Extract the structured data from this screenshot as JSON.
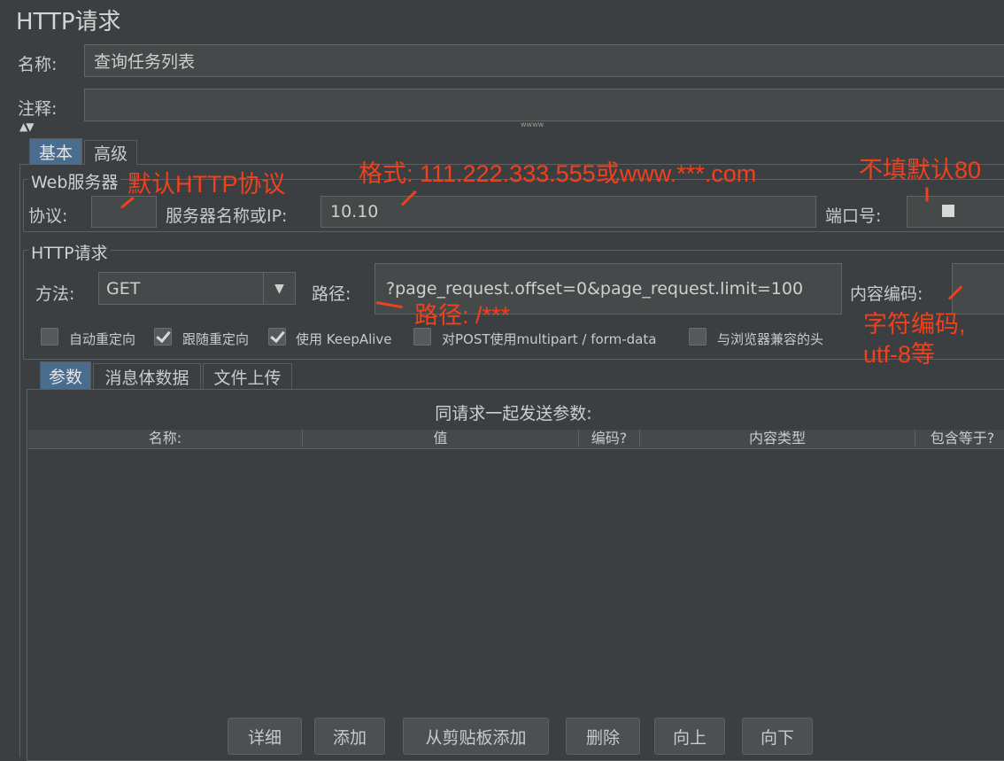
{
  "title": "HTTP请求",
  "name_label": "名称:",
  "name_value": "查询任务列表",
  "comment_label": "注释:",
  "comment_value": "",
  "collapse_icon": "▲▼",
  "splitter_icon": "wwww",
  "tabs": [
    "基本",
    "高级"
  ],
  "web_server": {
    "legend": "Web服务器",
    "protocol_label": "协议:",
    "protocol_value": "",
    "server_label": "服务器名称或IP:",
    "server_value": "10.10",
    "port_label": "端口号:",
    "port_value": ""
  },
  "http_request": {
    "legend": "HTTP请求",
    "method_label": "方法:",
    "method_value": "GET",
    "path_label": "路径:",
    "path_value": "?page_request.offset=0&page_request.limit=100",
    "encoding_label": "内容编码:",
    "encoding_value": ""
  },
  "checkboxes": [
    {
      "label": "自动重定向",
      "checked": false
    },
    {
      "label": "跟随重定向",
      "checked": true
    },
    {
      "label": "使用 KeepAlive",
      "checked": true
    },
    {
      "label": "对POST使用multipart / form-data",
      "checked": false
    },
    {
      "label": "与浏览器兼容的头",
      "checked": false
    }
  ],
  "subtabs": [
    "参数",
    "消息体数据",
    "文件上传"
  ],
  "params_caption": "同请求一起发送参数:",
  "columns": [
    "名称:",
    "值",
    "编码?",
    "内容类型",
    "包含等于?"
  ],
  "buttons": [
    "详细",
    "添加",
    "从剪贴板添加",
    "删除",
    "向上",
    "向下"
  ],
  "annotations": {
    "protocol_note": "默认HTTP协议",
    "format_note": "格式: 111.222.333.555或www.***.com",
    "port_note": "不填默认80",
    "path_note": "路径: /***",
    "encoding_note_1": "字符编码,",
    "encoding_note_2": "utf-8等"
  },
  "accent_color": "#4a6c8f",
  "annotation_color": "#f0401c"
}
